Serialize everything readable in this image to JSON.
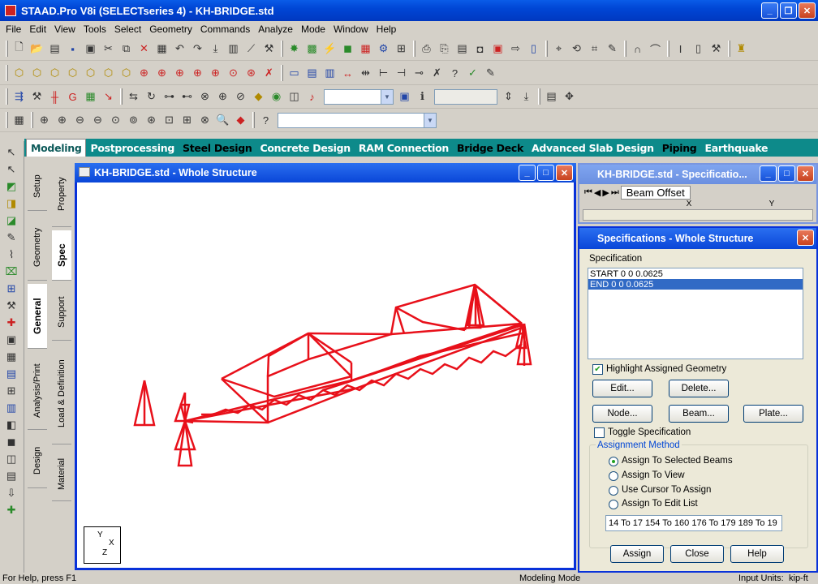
{
  "app": {
    "title": "STAAD.Pro V8i (SELECTseries 4) - KH-BRIDGE.std"
  },
  "colors": {
    "titlebar": "#0046d5",
    "pagebar": "#0d8a8a",
    "structure": "#e8101a"
  },
  "menu": [
    "File",
    "Edit",
    "View",
    "Tools",
    "Select",
    "Geometry",
    "Commands",
    "Analyze",
    "Mode",
    "Window",
    "Help"
  ],
  "pages": [
    "Modeling",
    "Postprocessing",
    "Steel Design",
    "Concrete Design",
    "RAM Connection",
    "Bridge Deck",
    "Advanced Slab Design",
    "Piping",
    "Earthquake"
  ],
  "side_tabs_outer": [
    "Setup",
    "Geometry",
    "General",
    "Analysis/Print",
    "Design"
  ],
  "side_tabs_inner": [
    "Property",
    "Spec",
    "Support",
    "Load & Definition",
    "Material"
  ],
  "viewport": {
    "title": "KH-BRIDGE.std - Whole Structure",
    "axis": {
      "y": "Y",
      "x": "X",
      "z": "Z"
    }
  },
  "beam_offset_window": {
    "title": "KH-BRIDGE.std - Specificatio...",
    "tab": "Beam Offset",
    "columns": [
      "X",
      "Y"
    ]
  },
  "spec_panel": {
    "title": "Specifications - Whole Structure",
    "section_label": "Specification",
    "items": [
      {
        "text": "START 0 0 0.0625",
        "selected": false
      },
      {
        "text": "END 0 0 0.0625",
        "selected": true
      }
    ],
    "highlight_label": "Highlight Assigned Geometry",
    "highlight_checked": true,
    "edit_btn": "Edit...",
    "delete_btn": "Delete...",
    "node_btn": "Node...",
    "beam_btn": "Beam...",
    "plate_btn": "Plate...",
    "toggle_label": "Toggle Specification",
    "toggle_checked": false,
    "assign_method_label": "Assignment Method",
    "methods": [
      "Assign To Selected Beams",
      "Assign To View",
      "Use Cursor To Assign",
      "Assign To Edit List"
    ],
    "selected_method": 0,
    "edit_list": "14 To 17 154 To 160 176 To 179 189 To 19",
    "assign_btn": "Assign",
    "close_btn": "Close",
    "help_btn": "Help"
  },
  "status": {
    "help": "For Help, press F1",
    "mode": "Modeling Mode",
    "units_label": "Input Units:",
    "units": "kip-ft"
  }
}
